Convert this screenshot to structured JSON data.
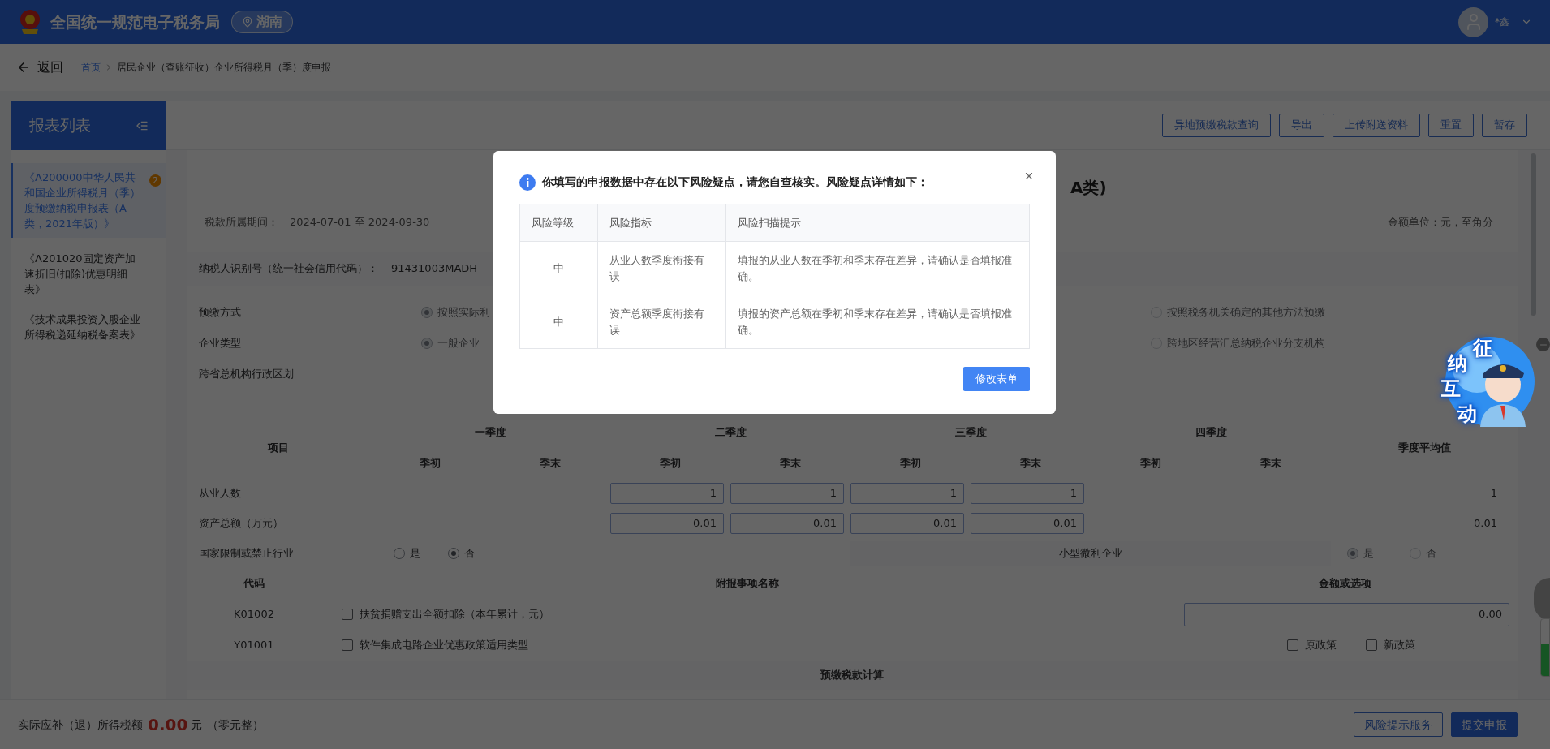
{
  "header": {
    "title": "全国统一规范电子税务局",
    "region": "湖南",
    "user": "*鑫"
  },
  "nav": {
    "back": "返回",
    "breadcrumb": [
      "首页",
      "居民企业（查账征收）企业所得税月（季）度申报"
    ]
  },
  "sidebar": {
    "title": "报表列表",
    "items": [
      {
        "label": "《A200000中华人民共和国企业所得税月（季）度预缴纳税申报表（A类，2021年版）》",
        "selected": true,
        "badge": "2"
      },
      {
        "label": "《A201020固定资产加速折旧(扣除)优惠明细表》",
        "selected": false
      },
      {
        "label": "《技术成果投资入股企业所得税递延纳税备案表》",
        "selected": false
      }
    ]
  },
  "toolbar": [
    "异地预缴税款查询",
    "导出",
    "上传附送资料",
    "重置",
    "暂存"
  ],
  "form": {
    "title": "A类)",
    "period_label": "税款所属期间：",
    "period": "2024-07-01 至 2024-09-30",
    "unit": "金额单位：元，至角分",
    "taxpayer_label": "纳税人识别号（统一社会信用代码）：",
    "taxpayer_id": "91431003MADH",
    "option_rows": [
      {
        "label": "预缴方式",
        "choices": [
          {
            "label": "按照实际利",
            "selected": true,
            "disabled": true
          },
          {
            "label": "按照税务机关确定的其他方法预缴",
            "selected": false,
            "disabled": true
          }
        ]
      },
      {
        "label": "企业类型",
        "choices": [
          {
            "label": "一般企业",
            "selected": true,
            "disabled": true
          },
          {
            "label": "跨地区经营汇总纳税企业分支机构",
            "selected": false,
            "disabled": true
          }
        ]
      },
      {
        "label": "跨省总机构行政区划"
      }
    ],
    "quarter_table": {
      "item_label": "项目",
      "quarters": [
        {
          "name": "一季度",
          "start": "季初",
          "end": "季末"
        },
        {
          "name": "二季度",
          "start": "季初",
          "end": "季末"
        },
        {
          "name": "三季度",
          "start": "季初",
          "end": "季末"
        },
        {
          "name": "四季度",
          "start": "季初",
          "end": "季末"
        }
      ],
      "average_label": "季度平均值",
      "rows": [
        {
          "label": "从业人数",
          "inputs": [
            "1",
            "1",
            "1",
            "1"
          ],
          "average": "1"
        },
        {
          "label": "资产总额（万元）",
          "inputs": [
            "0.01",
            "0.01",
            "0.01",
            "0.01"
          ],
          "average": "0.01"
        }
      ]
    },
    "restricted": {
      "label": "国家限制或禁止行业",
      "choices": [
        {
          "label": "是",
          "selected": false,
          "disabled": false
        },
        {
          "label": "否",
          "selected": true,
          "disabled": false
        }
      ]
    },
    "small_micro": {
      "label": "小型微利企业",
      "choices": [
        {
          "label": "是",
          "selected": true,
          "disabled": true
        },
        {
          "label": "否",
          "selected": false,
          "disabled": true
        }
      ]
    },
    "attachments": {
      "columns": [
        "代码",
        "附报事项名称",
        "金额或选项"
      ],
      "rows": [
        {
          "code": "K01002",
          "label": "扶贫捐赠支出全额扣除（本年累计，元）",
          "checked": false,
          "kind": "amount",
          "value": "0.00"
        },
        {
          "code": "Y01001",
          "label": "软件集成电路企业优惠政策适用类型",
          "checked": false,
          "kind": "policy",
          "options": [
            {
              "label": "原政策",
              "checked": false
            },
            {
              "label": "新政策",
              "checked": false
            }
          ]
        }
      ]
    },
    "section_title": "预缴税款计算"
  },
  "footer": {
    "label": "实际应补（退）所得税额",
    "amount": "0.00",
    "unit": "元",
    "words": "（零元整）",
    "buttons": [
      {
        "label": "风险提示服务",
        "primary": false
      },
      {
        "label": "提交申报",
        "primary": true
      }
    ]
  },
  "modal": {
    "message": "你填写的申报数据中存在以下风险疑点，请您自查核实。风险疑点详情如下：",
    "columns": [
      "风险等级",
      "风险指标",
      "风险扫描提示"
    ],
    "rows": [
      {
        "level": "中",
        "indicator": "从业人数季度衔接有误",
        "hint": "填报的从业人数在季初和季末存在差异，请确认是否填报准确。"
      },
      {
        "level": "中",
        "indicator": "资产总额季度衔接有误",
        "hint": "填报的资产总额在季初和季末存在差异，请确认是否填报准确。"
      }
    ],
    "button": "修改表单"
  },
  "mascot": {
    "chars": [
      "征",
      "纳",
      "互",
      "动"
    ]
  }
}
